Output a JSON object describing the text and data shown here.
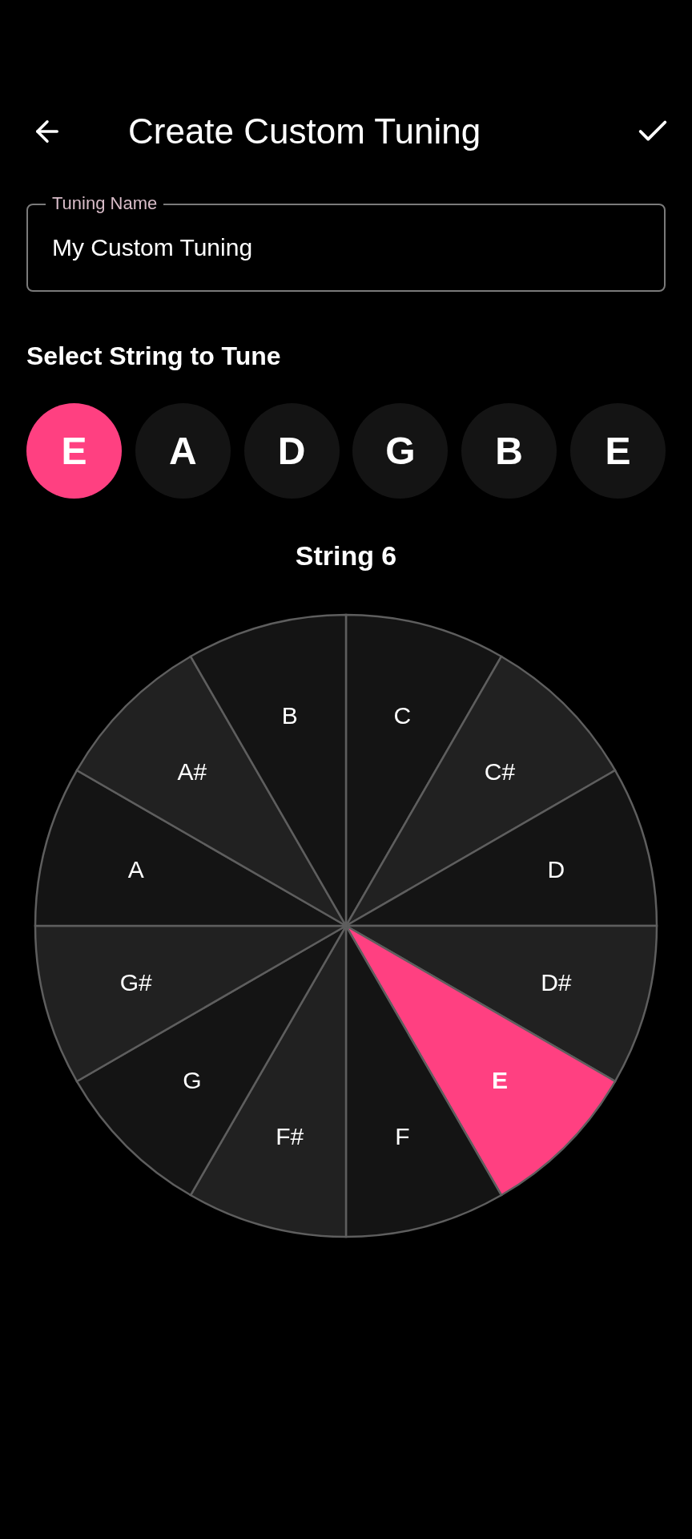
{
  "header": {
    "title": "Create Custom Tuning"
  },
  "tuning_name": {
    "label": "Tuning Name",
    "value": "My Custom Tuning"
  },
  "section_title": "Select String to Tune",
  "strings": [
    {
      "note": "E",
      "selected": true
    },
    {
      "note": "A",
      "selected": false
    },
    {
      "note": "D",
      "selected": false
    },
    {
      "note": "G",
      "selected": false
    },
    {
      "note": "B",
      "selected": false
    },
    {
      "note": "E",
      "selected": false
    }
  ],
  "current_string": "String 6",
  "wheel": [
    {
      "note": "C",
      "kind": "natural",
      "selected": false
    },
    {
      "note": "C#",
      "kind": "sharp",
      "selected": false
    },
    {
      "note": "D",
      "kind": "natural",
      "selected": false
    },
    {
      "note": "D#",
      "kind": "sharp",
      "selected": false
    },
    {
      "note": "E",
      "selected": true
    },
    {
      "note": "F",
      "kind": "natural",
      "selected": false
    },
    {
      "note": "F#",
      "kind": "sharp",
      "selected": false
    },
    {
      "note": "G",
      "kind": "natural",
      "selected": false
    },
    {
      "note": "G#",
      "kind": "sharp",
      "selected": false
    },
    {
      "note": "A",
      "kind": "natural",
      "selected": false
    },
    {
      "note": "A#",
      "kind": "sharp",
      "selected": false
    },
    {
      "note": "B",
      "kind": "natural",
      "selected": false
    }
  ]
}
